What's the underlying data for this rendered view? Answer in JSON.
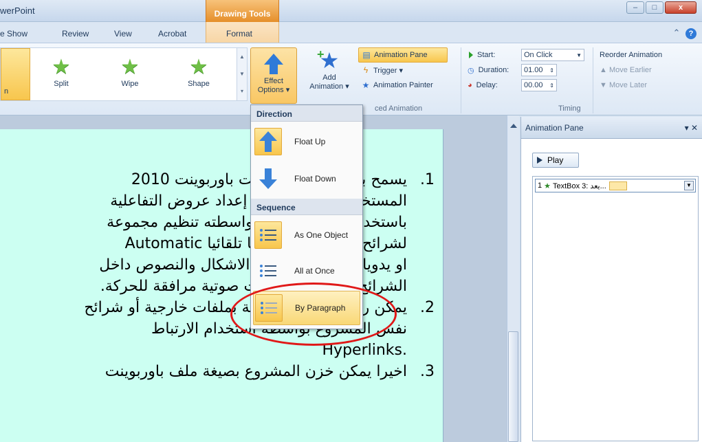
{
  "window": {
    "title": "werPoint",
    "context_tab_group": "Drawing Tools",
    "controls": [
      "–",
      "□",
      "x"
    ]
  },
  "tabs": [
    {
      "label": "e Show"
    },
    {
      "label": "Review"
    },
    {
      "label": "View"
    },
    {
      "label": "Acrobat"
    },
    {
      "label": "Format"
    }
  ],
  "ribbon": {
    "animations": [
      {
        "label": "n"
      },
      {
        "label": "Split"
      },
      {
        "label": "Wipe"
      },
      {
        "label": "Shape"
      }
    ],
    "effect_options": {
      "line1": "Effect",
      "line2": "Options ▾"
    },
    "add_animation": {
      "line1": "Add",
      "line2": "Animation ▾"
    },
    "advanced": {
      "animation_pane": "Animation Pane",
      "trigger": "Trigger ▾",
      "animation_painter": "Animation Painter",
      "group_label": "ced Animation"
    },
    "timing": {
      "start_label": "Start:",
      "start_value": "On Click",
      "duration_label": "Duration:",
      "duration_value": "01.00",
      "delay_label": "Delay:",
      "delay_value": "00.00",
      "group_label": "Timing"
    },
    "reorder": {
      "title": "Reorder Animation",
      "move_earlier": "Move Earlier",
      "move_later": "Move Later"
    }
  },
  "dropdown": {
    "direction_header": "Direction",
    "float_up": "Float Up",
    "float_down": "Float Down",
    "sequence_header": "Sequence",
    "as_one_object": "As One Object",
    "all_at_once": "All at Once",
    "by_paragraph": "By Paragraph"
  },
  "slide": {
    "lines": [
      {
        "num": "1.",
        "text": "يسمح برنامج مايكروسوفت باوربوينت 2010"
      },
      {
        "num": "",
        "text": "المستخدم بالمشاركة في إعداد عروض التفاعلية"
      },
      {
        "num": "",
        "text": "باستخدام Slides يمكن بواسطته تنظيم مجموعة"
      },
      {
        "num": "",
        "text": "لشرائح بشكل متعاقب أما تلقائيا Automatic"
      },
      {
        "num": "",
        "text": "او يدويا Manual وتنظيم الاشكال والنصوص داخل"
      },
      {
        "num": "",
        "text": "الشرائح مع إضافة مؤثرات صوتية مرافقة للحركة."
      },
      {
        "num": "2.",
        "text": "يمكن ربط عناصر الشريحة بملفات خارجية أو شرائح"
      },
      {
        "num": "",
        "text": "نفس المشروع بواسطة استخدام الارتباط"
      },
      {
        "num": "",
        "text": ".Hyperlinks"
      },
      {
        "num": "3.",
        "text": "اخيرا يمكن خزن المشروع بصيغة ملف باوربوينت"
      }
    ]
  },
  "animation_pane": {
    "title": "Animation Pane",
    "play": "Play",
    "entries": [
      {
        "index": "1",
        "label": "TextBox 3: يعد..."
      }
    ]
  },
  "colors": {
    "slide_background": "#ccfff2",
    "highlight": "#f8c64d",
    "annotation_circle": "#e01818"
  }
}
